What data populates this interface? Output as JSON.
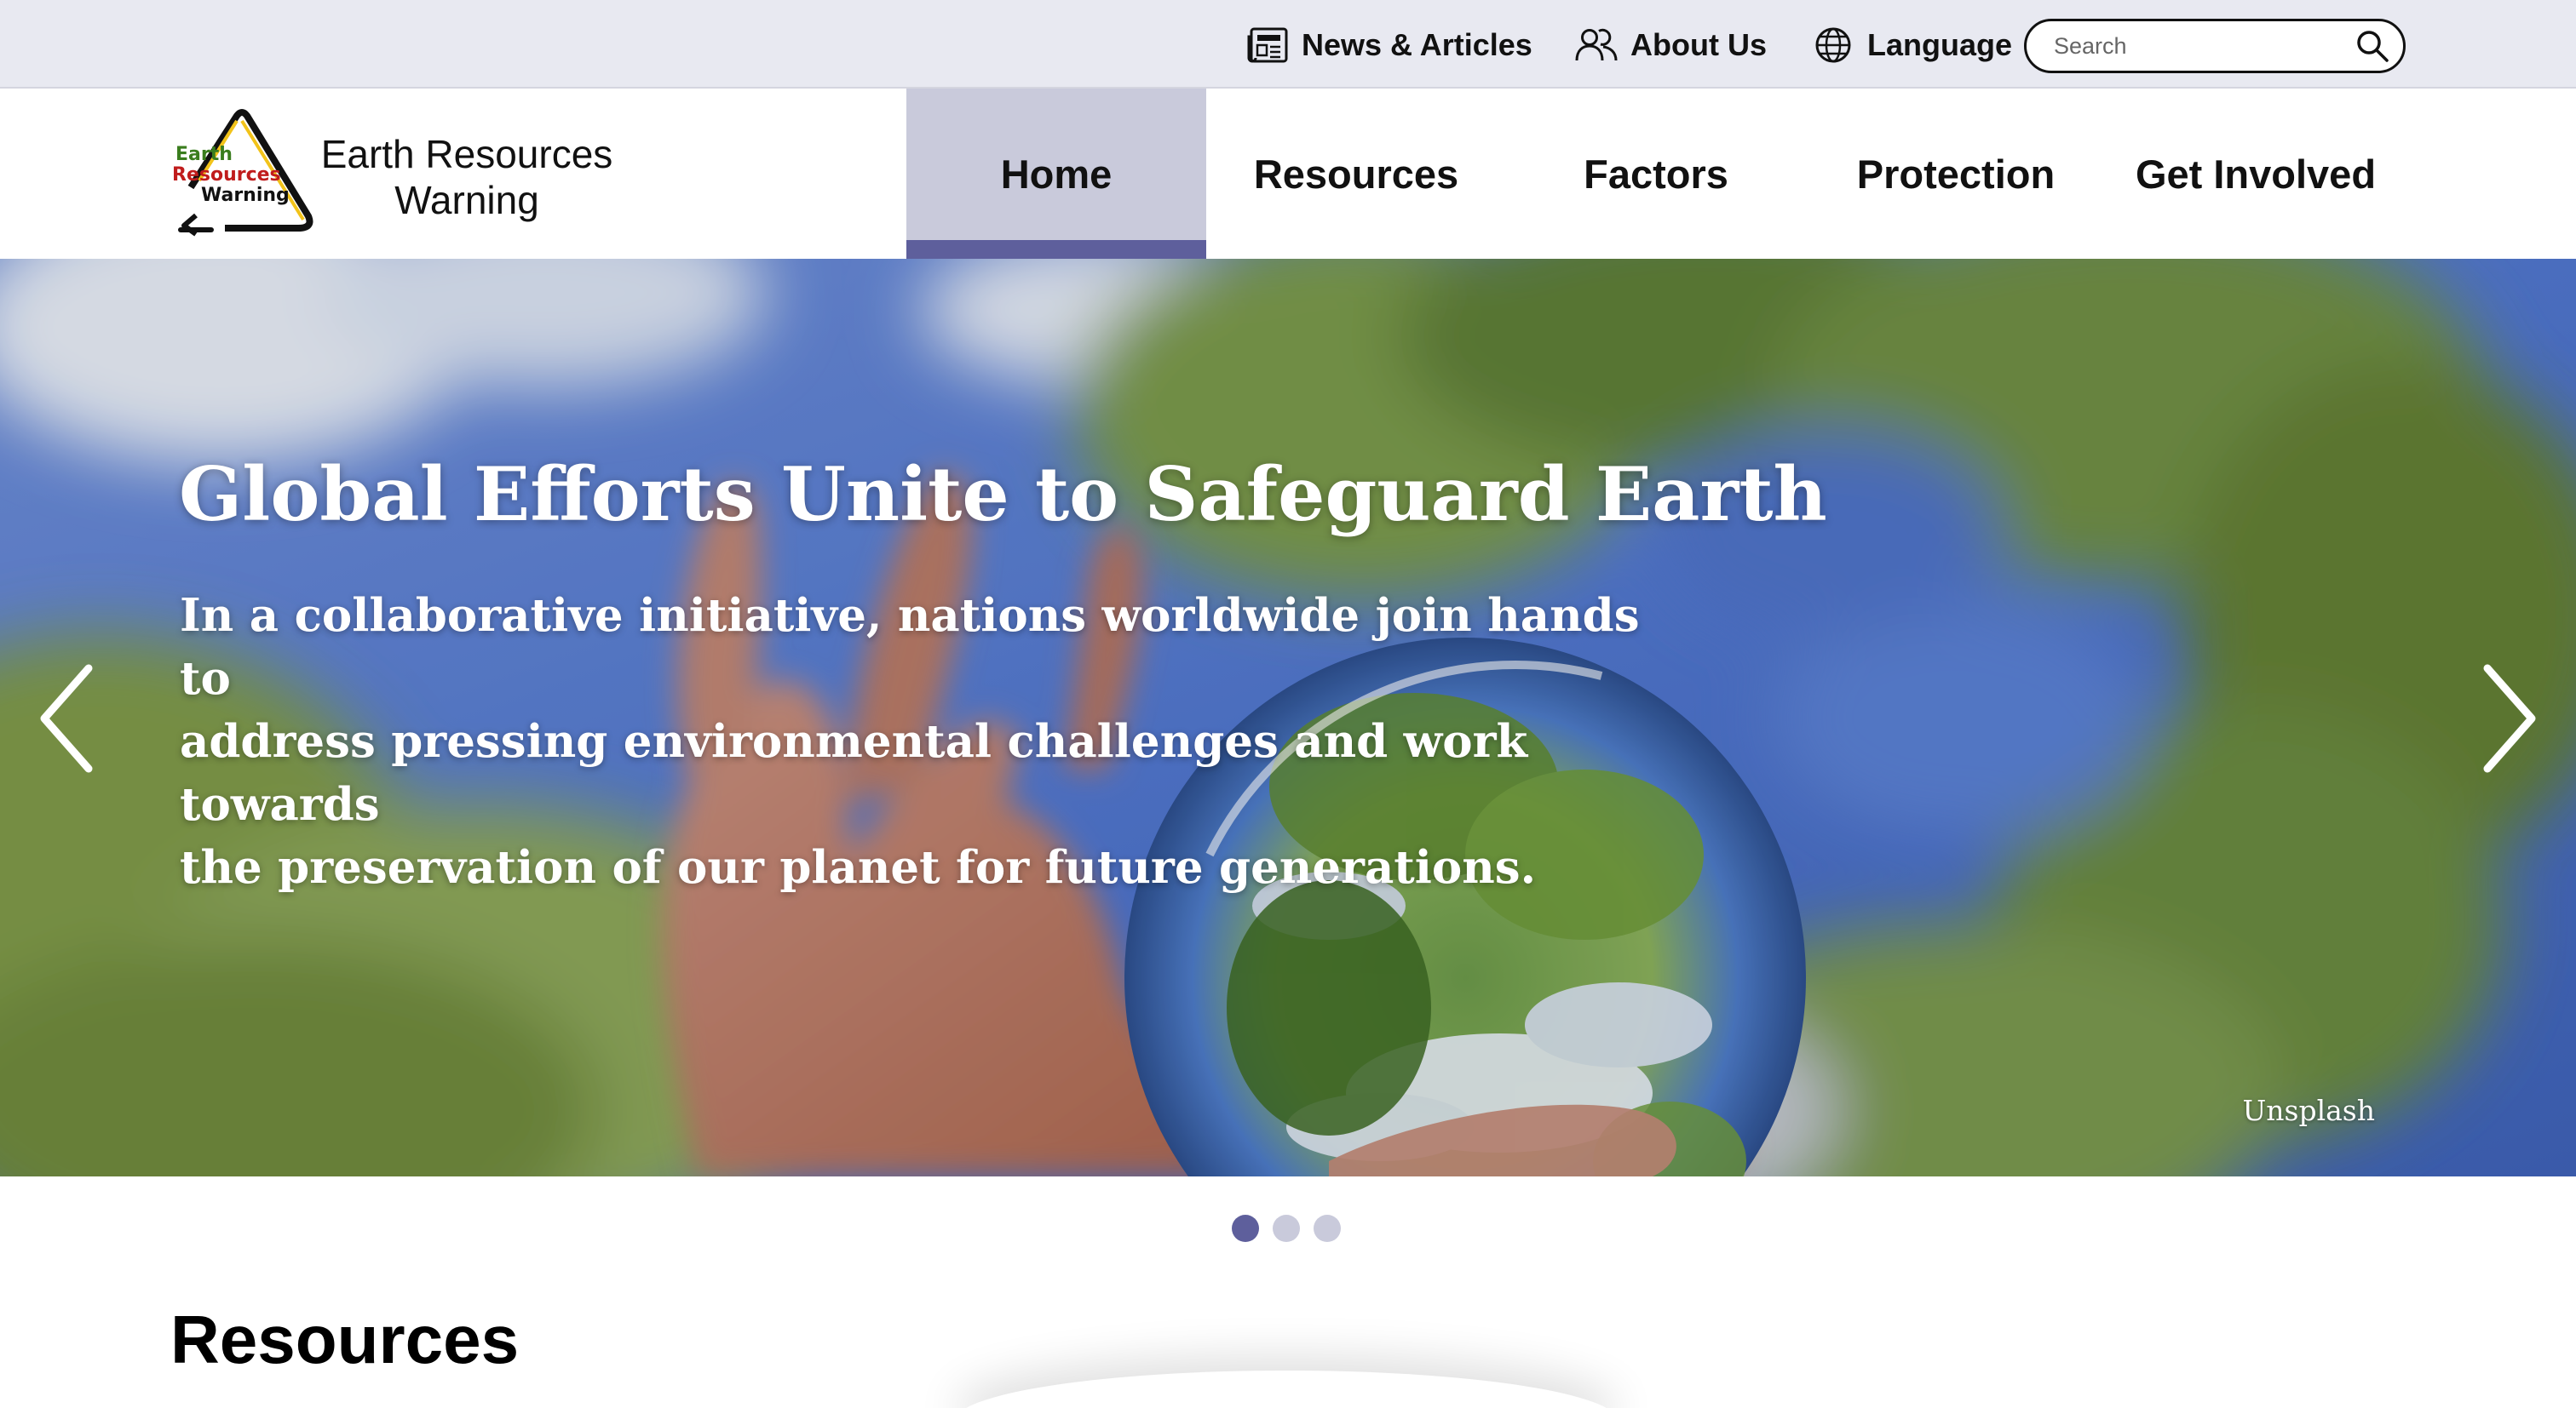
{
  "utility_bar": {
    "news_label": "News & Articles",
    "about_label": "About Us",
    "language_label": "Language",
    "search_placeholder": "Search"
  },
  "header": {
    "site_title_line1": "Earth Resources",
    "site_title_line2": "Warning",
    "logo_text": [
      "Earth",
      "Resources",
      "Warning"
    ]
  },
  "nav": {
    "items": [
      {
        "label": "Home",
        "active": true
      },
      {
        "label": "Resources",
        "active": false
      },
      {
        "label": "Factors",
        "active": false
      },
      {
        "label": "Protection",
        "active": false
      },
      {
        "label": "Get Involved",
        "active": false
      }
    ]
  },
  "hero": {
    "title": "Global Efforts Unite to Safeguard Earth",
    "subtitle_lines": [
      "In a collaborative initiative, nations worldwide join hands to",
      "address pressing environmental challenges and work towards",
      "the preservation of our planet for future generations."
    ],
    "credit": "Unsplash",
    "slide_count": 3,
    "active_slide": 1
  },
  "section": {
    "title": "Resources"
  },
  "colors": {
    "accent": "#5e5f9c",
    "nav_active_bg": "#c9cadb",
    "utility_bg": "#e8e9f1"
  },
  "icons": {
    "news": "newspaper-icon",
    "about": "users-icon",
    "language": "globe-icon",
    "search": "search-icon",
    "prev": "chevron-left-icon",
    "next": "chevron-right-icon"
  }
}
